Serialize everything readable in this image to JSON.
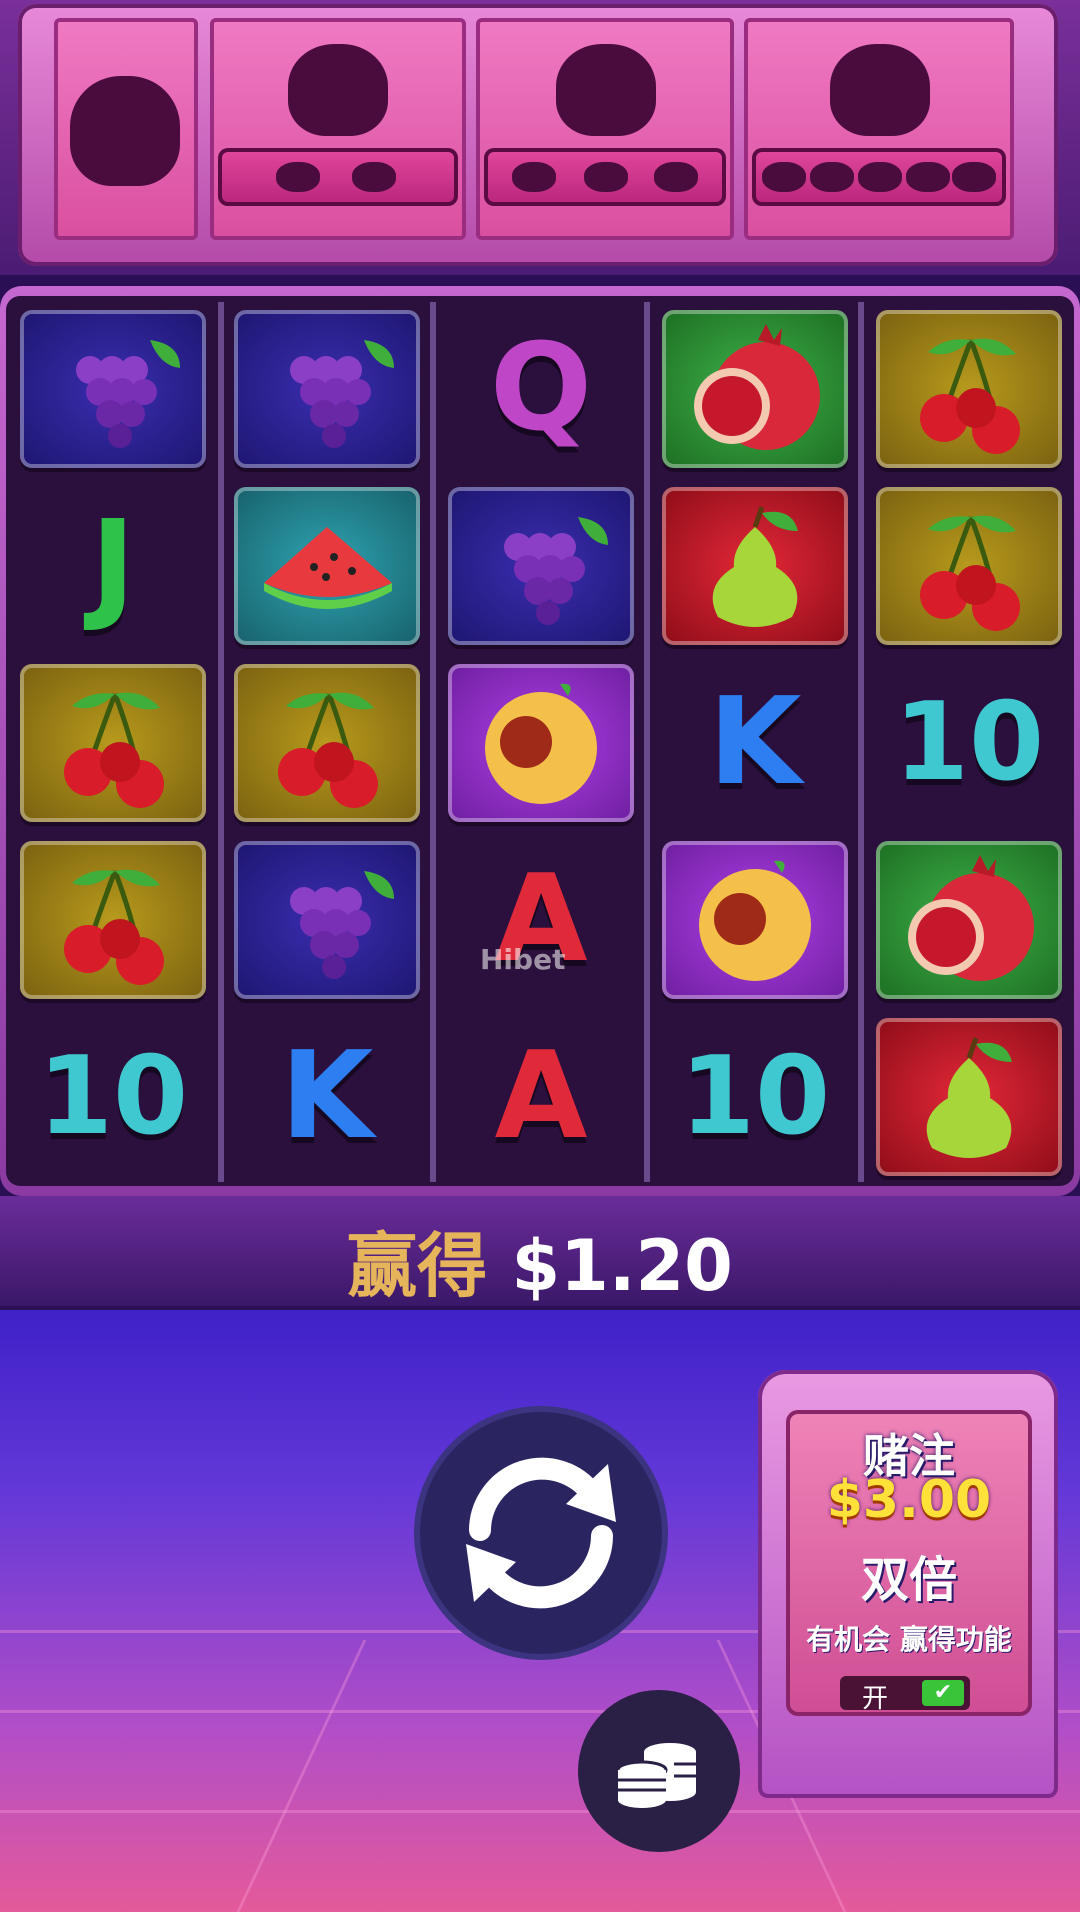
{
  "win": {
    "label": "赢得",
    "amount": "$1.20"
  },
  "bet": {
    "title": "赌注",
    "amount": "$3.00",
    "double_label": "双倍",
    "chance_label": "有机会 赢得功能",
    "toggle_label": "开",
    "toggle_state": "on"
  },
  "reels": [
    [
      "grapes",
      "J",
      "cherry",
      "cherry",
      "10"
    ],
    [
      "grapes",
      "watermelon",
      "cherry",
      "grapes",
      "K"
    ],
    [
      "Q",
      "grapes",
      "peach",
      "A",
      "A"
    ],
    [
      "pomegranate",
      "pear",
      "K",
      "peach",
      "10"
    ],
    [
      "cherry",
      "cherry",
      "10",
      "pomegranate",
      "pear"
    ]
  ],
  "watermark": "Hibet",
  "colors": {
    "win_label": "#e6b45a",
    "bet_amount": "#ffe13a"
  }
}
